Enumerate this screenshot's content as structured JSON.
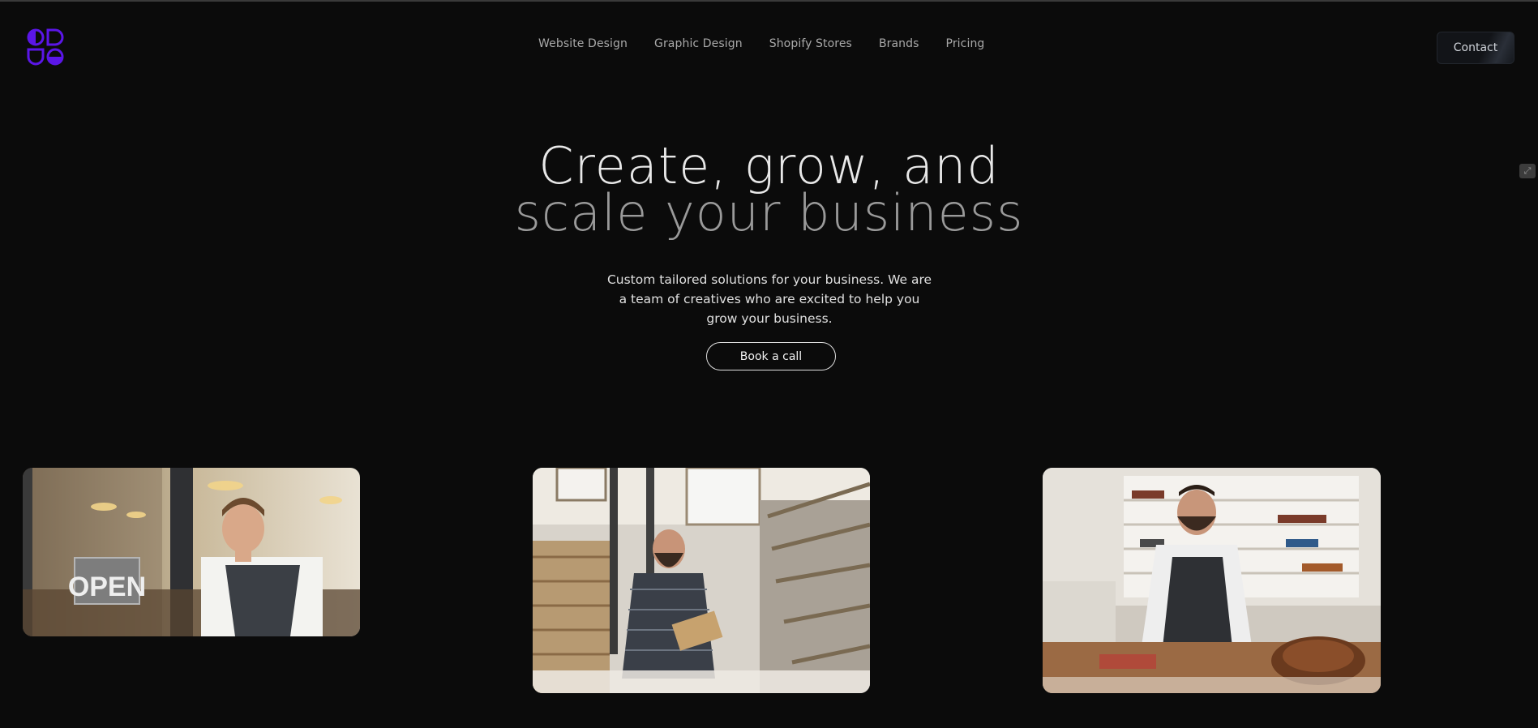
{
  "header": {
    "nav": [
      {
        "label": "Website Design"
      },
      {
        "label": "Graphic Design"
      },
      {
        "label": "Shopify Stores"
      },
      {
        "label": "Brands"
      },
      {
        "label": "Pricing"
      }
    ],
    "contact_label": "Contact"
  },
  "hero": {
    "title_line1": "Create, grow, and",
    "title_line2": "scale your business",
    "subtitle": "Custom tailored solutions for your business. We are a team of creatives who are excited to help you grow your business.",
    "cta_label": "Book a call"
  },
  "gallery": {
    "card1": {
      "sign_text": "OPEN"
    }
  },
  "colors": {
    "background": "#0b0b0b",
    "logo_accent": "#5b16e8",
    "title_primary": "#e8e8e8",
    "title_secondary": "#9a9a9a"
  },
  "icons": {
    "logo": "brand-logo-icon",
    "side_widget": "expand-icon"
  }
}
